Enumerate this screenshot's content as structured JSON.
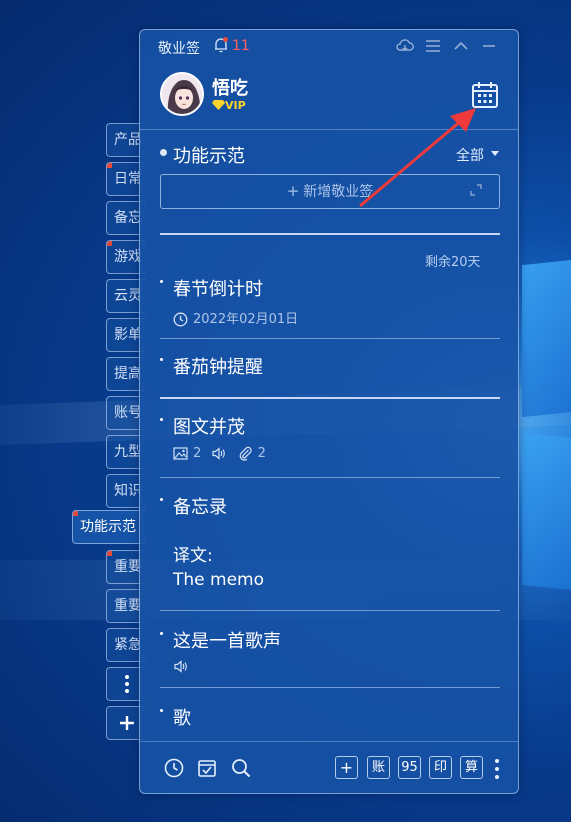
{
  "app": {
    "title": "敬业签",
    "notification_count": "11"
  },
  "user": {
    "name": "悟吃",
    "badge": "VIP"
  },
  "side_tabs": [
    {
      "label": "产品",
      "flag": false
    },
    {
      "label": "日常",
      "flag": true
    },
    {
      "label": "备忘",
      "flag": false
    },
    {
      "label": "游戏",
      "flag": true
    },
    {
      "label": "云灵",
      "flag": false
    },
    {
      "label": "影单",
      "flag": false
    },
    {
      "label": "提高",
      "flag": false
    },
    {
      "label": "账号",
      "flag": false
    },
    {
      "label": "九型",
      "flag": false
    },
    {
      "label": "知识",
      "flag": false
    },
    {
      "label": "功能示范",
      "flag": true,
      "active": true
    },
    {
      "label": "重要",
      "flag": true
    },
    {
      "label": "重要",
      "flag": false
    },
    {
      "label": "紧急",
      "flag": false
    }
  ],
  "category": {
    "title": "功能示范",
    "filter": "全部"
  },
  "add_note": {
    "plus": "+",
    "label": "新增敬业签"
  },
  "remaining": "剩余20天",
  "notes": [
    {
      "title": "春节倒计时",
      "date": "2022年02月01日"
    },
    {
      "title": "番茄钟提醒"
    },
    {
      "title": "图文并茂",
      "image_count": "2",
      "attachment_count": "2"
    },
    {
      "title": "备忘录",
      "body_line1": "译文:",
      "body_line2": "The memo"
    },
    {
      "title": "这是一首歌声"
    },
    {
      "title": "歌"
    }
  ],
  "footer": {
    "buttons": [
      "+",
      "账",
      "95",
      "印",
      "算"
    ]
  },
  "colors": {
    "panel_bg": "#1652a5",
    "accent_red": "#e84a3a",
    "vip_gold": "#ffd42a"
  }
}
